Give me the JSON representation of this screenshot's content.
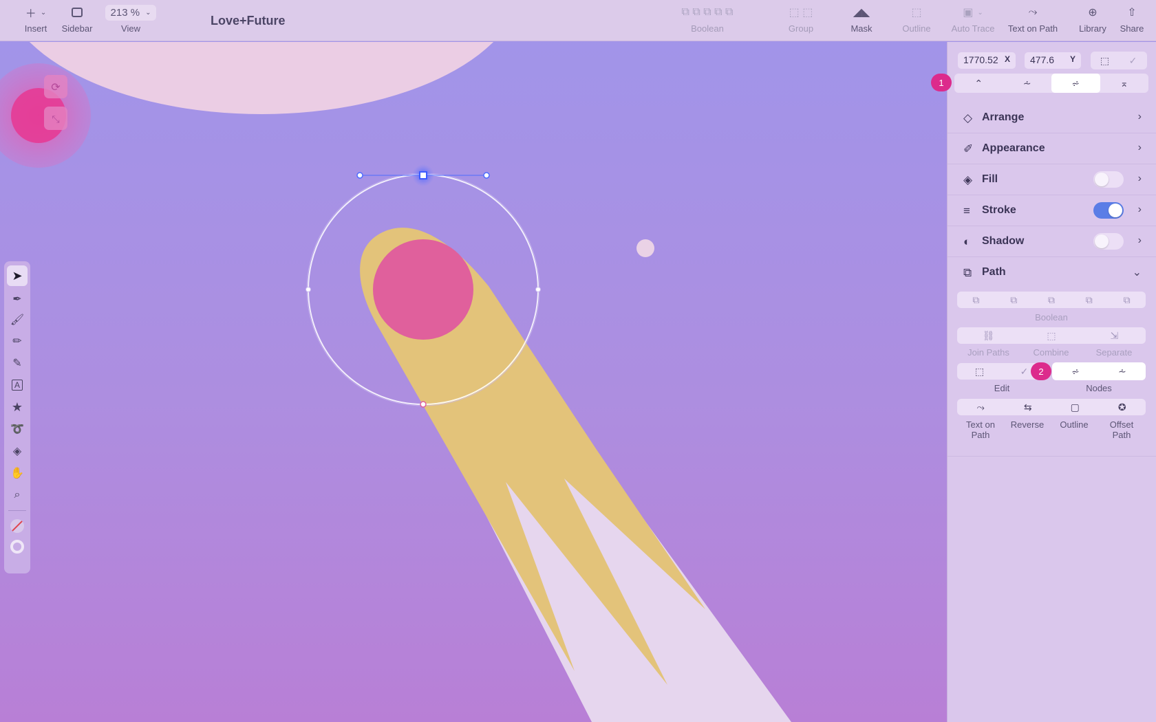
{
  "app": {
    "document_title": "Love+Future"
  },
  "toolbar": {
    "insert_label": "Insert",
    "sidebar_label": "Sidebar",
    "view_label": "View",
    "zoom_value": "213 %",
    "boolean_label": "Boolean",
    "group_label": "Group",
    "mask_label": "Mask",
    "outline_label": "Outline",
    "auto_trace_label": "Auto Trace",
    "text_on_path_label": "Text on Path",
    "library_label": "Library",
    "share_label": "Share"
  },
  "inspector": {
    "x_value": "1770.52",
    "x_axis": "X",
    "y_value": "477.6",
    "y_axis": "Y",
    "node_type_badge": "1",
    "sections": {
      "arrange": "Arrange",
      "appearance": "Appearance",
      "fill": "Fill",
      "stroke": "Stroke",
      "shadow": "Shadow",
      "path": "Path"
    },
    "toggles": {
      "fill": false,
      "stroke": true,
      "shadow": false
    },
    "path": {
      "boolean_label": "Boolean",
      "join_paths_label": "Join Paths",
      "combine_label": "Combine",
      "separate_label": "Separate",
      "edit_label": "Edit",
      "nodes_label": "Nodes",
      "nodes_badge": "2",
      "text_on_path_label": "Text on\nPath",
      "reverse_label": "Reverse",
      "outline_label": "Outline",
      "offset_path_label": "Offset\nPath"
    }
  },
  "colors": {
    "canvas_top": "#a095ea",
    "canvas_bottom": "#b87fd6",
    "comet_tail": "#e3c37a",
    "comet_head": "#e0609c",
    "streak": "#e6d6ee",
    "moon": "#ebcde4",
    "accent_badge": "#dc2b8c",
    "toggle_on": "#5a7de6"
  }
}
